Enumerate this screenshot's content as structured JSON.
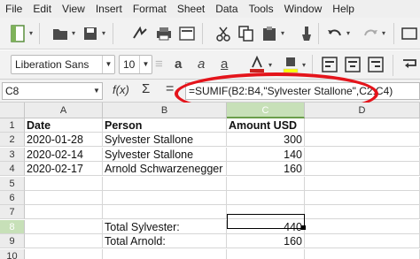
{
  "menubar": {
    "items": [
      "File",
      "Edit",
      "View",
      "Insert",
      "Format",
      "Sheet",
      "Data",
      "Tools",
      "Window",
      "Help"
    ]
  },
  "toolbar_standard": {
    "icons": [
      "new-icon",
      "open-icon",
      "save-icon",
      "export-pdf-icon",
      "print-icon",
      "print-preview-icon",
      "cut-icon",
      "copy-icon",
      "paste-icon",
      "clone-icon",
      "undo-icon",
      "redo-icon"
    ]
  },
  "toolbar_format": {
    "font_name": "Liberation Sans",
    "font_size": "10",
    "bold_label": "a",
    "italic_label": "a",
    "underline_label": "a",
    "font_color": "#c9211e",
    "highlight_color": "#ffff00"
  },
  "formula_bar": {
    "name_box": "C8",
    "fx_label": "f(x)",
    "sum_label": "Σ",
    "equals_label": "=",
    "formula": "=SUMIF(B2:B4,\"Sylvester Stallone\",C2:C4)"
  },
  "grid": {
    "columns": [
      "A",
      "B",
      "C",
      "D"
    ],
    "selected_column": "C",
    "rows": [
      "1",
      "2",
      "3",
      "4",
      "5",
      "6",
      "7",
      "8",
      "9",
      "10"
    ],
    "selected_row": "8",
    "cells": {
      "A1": "Date",
      "B1": "Person",
      "C1": "Amount USD",
      "A2": "2020-01-28",
      "B2": "Sylvester Stallone",
      "C2": "300",
      "A3": "2020-02-14",
      "B3": "Sylvester Stallone",
      "C3": "140",
      "A4": "2020-02-17",
      "B4": "Arnold Schwarzenegger",
      "C4": "160",
      "B8": "Total Sylvester:",
      "C8": "440",
      "B9": "Total Arnold:",
      "C9": "160"
    }
  },
  "colors": {
    "highlight_ellipse": "#e4141b",
    "selected_header": "#c7e0b8"
  }
}
